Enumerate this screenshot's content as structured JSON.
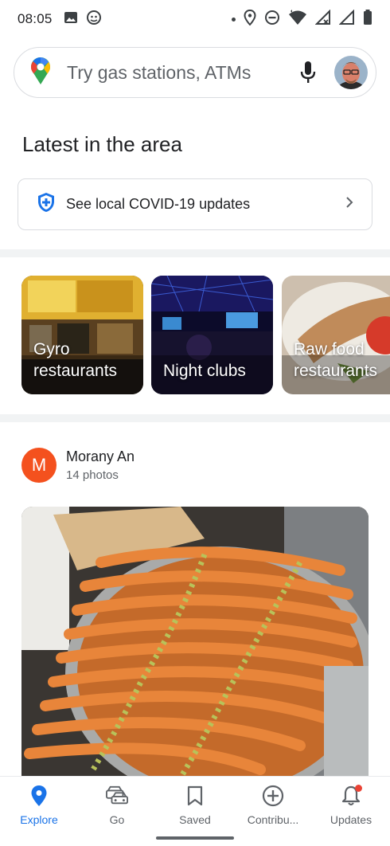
{
  "status_bar": {
    "time": "08:05",
    "left_icons": [
      "image-icon",
      "android-debug-icon"
    ],
    "right_icons": [
      "notification-dot-icon",
      "location-icon",
      "do-not-disturb-icon",
      "wifi-icon",
      "signal-icon",
      "signal-icon-2",
      "battery-icon"
    ]
  },
  "search": {
    "placeholder": "Try gas stations, ATMs",
    "icons": [
      "maps-pin-icon",
      "mic-icon"
    ]
  },
  "section": {
    "title": "Latest in the area"
  },
  "covid": {
    "label": "See local COVID-19 updates",
    "icon": "shield-plus-icon"
  },
  "categories": [
    {
      "label_line1": "Gyro",
      "label_line2": "restaurants"
    },
    {
      "label_line1": "Night clubs",
      "label_line2": ""
    },
    {
      "label_line1": "Raw food",
      "label_line2": "restaurants"
    }
  ],
  "post": {
    "avatar_letter": "M",
    "author": "Morany An",
    "photo_count": "14 photos"
  },
  "nav": {
    "items": [
      {
        "label": "Explore",
        "icon": "explore-pin-icon",
        "active": true
      },
      {
        "label": "Go",
        "icon": "car-icon",
        "active": false
      },
      {
        "label": "Saved",
        "icon": "bookmark-icon",
        "active": false
      },
      {
        "label": "Contribu...",
        "icon": "add-circle-icon",
        "active": false
      },
      {
        "label": "Updates",
        "icon": "bell-icon",
        "active": false
      }
    ]
  },
  "colors": {
    "accent": "#1a73e8",
    "avatar_bg": "#f4511e",
    "badge": "#ea4335"
  }
}
